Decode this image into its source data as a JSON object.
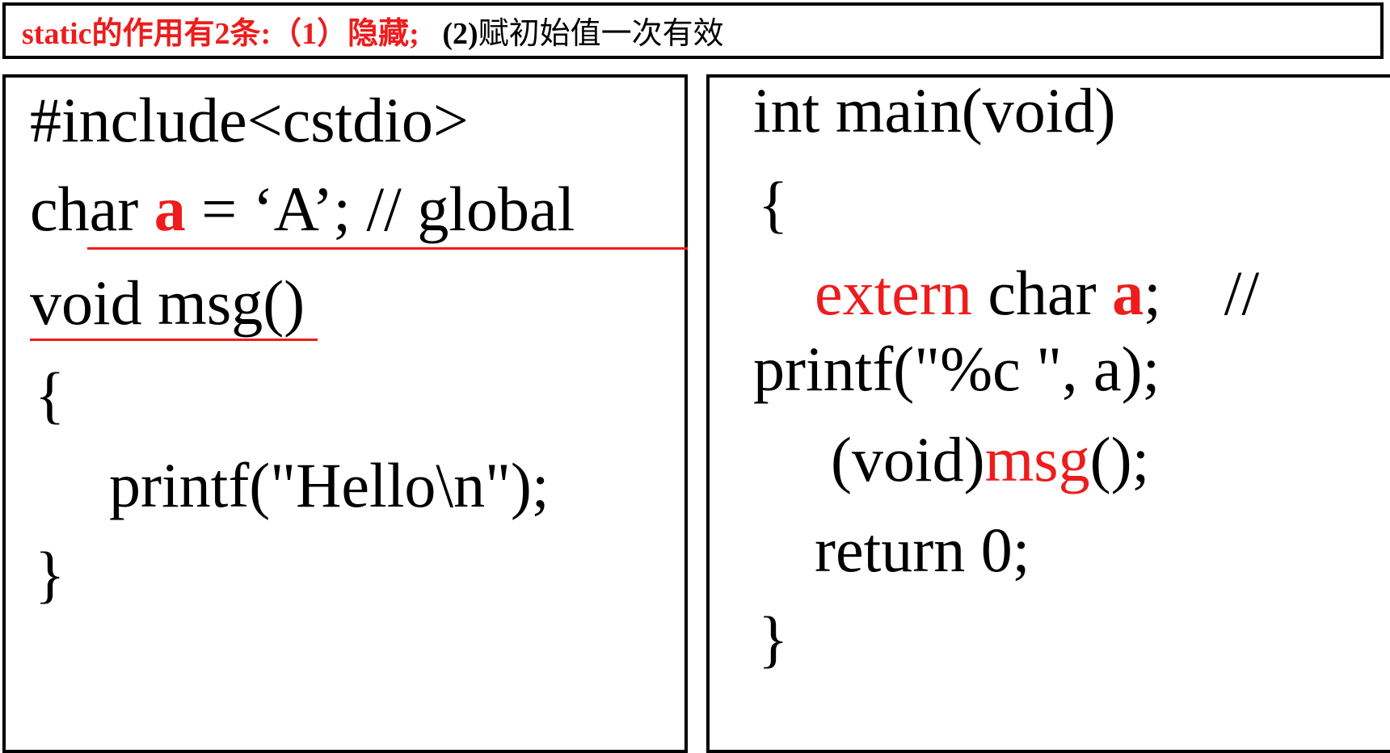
{
  "title": {
    "part1": "static的作用有2条:（1）隐藏;",
    "part2": "(2)",
    "part3": "赋初始值一次有效"
  },
  "left_code": {
    "line1": "#include<cstdio>",
    "line2_prefix": "char ",
    "line2_var": "a",
    "line2_suffix": " = ‘A’; // global",
    "line3": "void msg()",
    "line4": "{",
    "line5": "printf(\"Hello\\n\");",
    "line6": "}"
  },
  "right_code": {
    "line1": "int main(void)",
    "line2": "{",
    "line3_kw": "extern",
    "line3_mid": " char ",
    "line3_var": "a",
    "line3_suffix": ";    //",
    "line4": "printf(\"%c \", a);",
    "line5_prefix": "(void)",
    "line5_fn": "msg",
    "line5_suffix": "();",
    "line6": "return 0;",
    "line7": "}"
  },
  "colors": {
    "accent_red": "#ee1c1c",
    "text": "#000000"
  }
}
